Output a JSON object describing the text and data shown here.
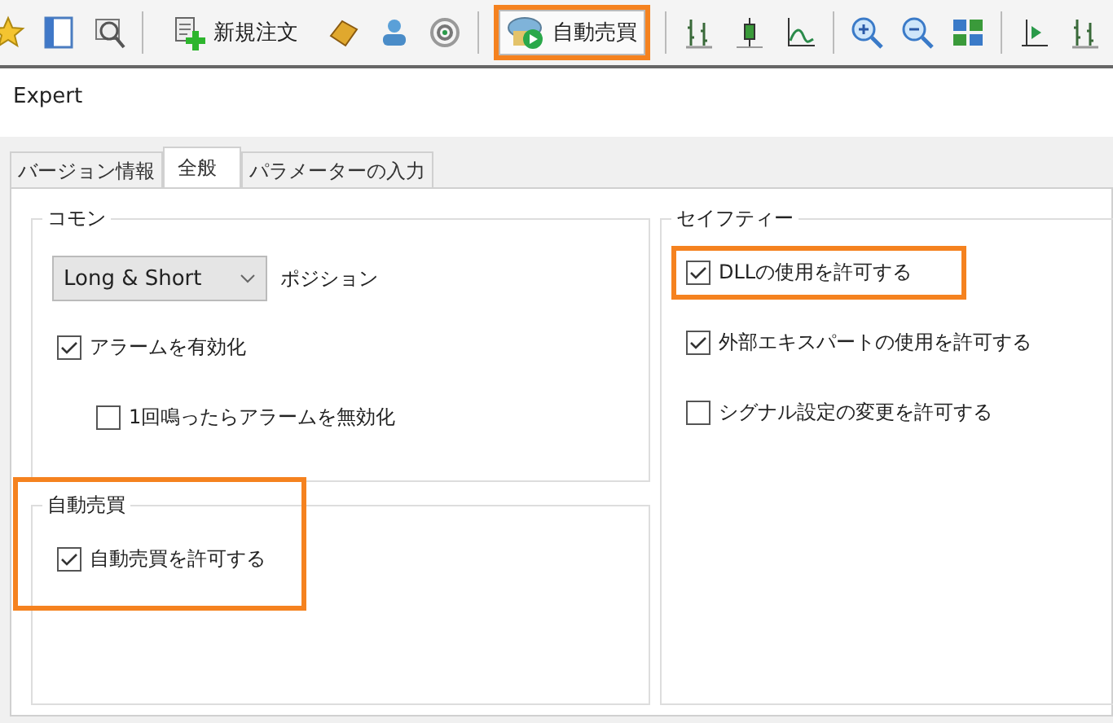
{
  "toolbar": [
    {
      "kind": "icon"
    },
    {
      "kind": "icon"
    },
    {
      "kind": "icon"
    },
    {
      "kind": "separator"
    },
    {
      "kind": "button",
      "label": "新規注文",
      "highlighted": false
    },
    {
      "kind": "icon"
    },
    {
      "kind": "icon"
    },
    {
      "kind": "icon"
    },
    {
      "kind": "separator"
    },
    {
      "kind": "button",
      "label": "自動売買",
      "highlighted": true
    },
    {
      "kind": "separator"
    },
    {
      "kind": "icon"
    },
    {
      "kind": "icon"
    },
    {
      "kind": "icon"
    },
    {
      "kind": "separator"
    },
    {
      "kind": "icon"
    },
    {
      "kind": "icon"
    },
    {
      "kind": "icon"
    },
    {
      "kind": "separator"
    },
    {
      "kind": "icon"
    },
    {
      "kind": "icon"
    }
  ],
  "window": {
    "title": "Expert"
  },
  "tabs": [
    {
      "label": "バージョン情報",
      "selected": false
    },
    {
      "label": "全般",
      "selected": true
    },
    {
      "label": "パラメーターの入力",
      "selected": false
    }
  ],
  "common": {
    "title": "コモン",
    "position_select": {
      "value": "Long & Short"
    },
    "position_label": "ポジション",
    "options": [
      {
        "label": "アラームを有効化",
        "checked": true,
        "children": [
          {
            "label": "1回鳴ったらアラームを無効化",
            "checked": false
          }
        ]
      }
    ]
  },
  "auto_trading": {
    "title": "自動売買",
    "highlighted": true,
    "options": [
      {
        "label": "自動売買を許可する",
        "checked": true
      }
    ]
  },
  "safety": {
    "title": "セイフティー",
    "options": [
      {
        "label": "DLLの使用を許可する",
        "checked": true,
        "highlighted": true
      },
      {
        "label": "外部エキスパートの使用を許可する",
        "checked": true,
        "highlighted": false
      },
      {
        "label": "シグナル設定の変更を許可する",
        "checked": false,
        "highlighted": false
      }
    ]
  }
}
